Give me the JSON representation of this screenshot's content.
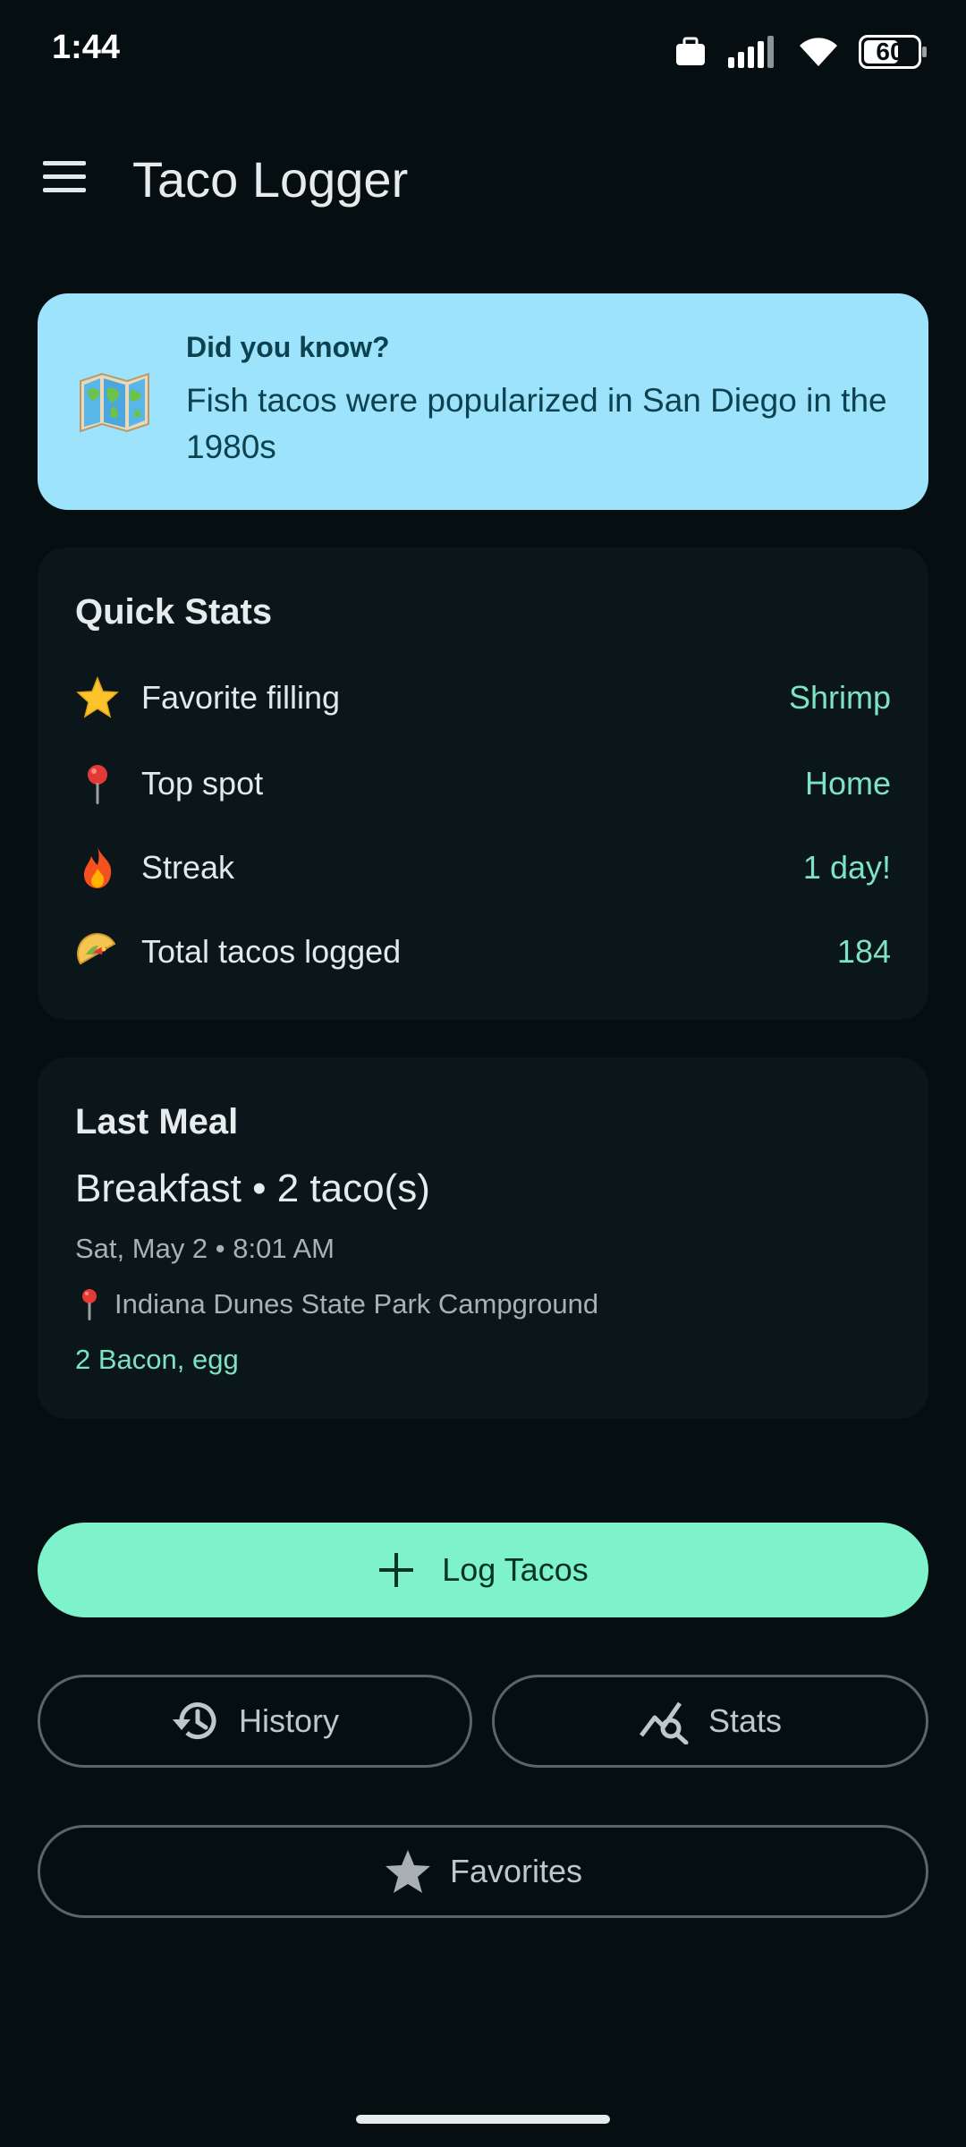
{
  "status_bar": {
    "time": "1:44",
    "battery": "60",
    "battery_level": 0.6,
    "icons": [
      "work-briefcase-icon",
      "signal-icon",
      "wifi-icon",
      "battery-icon"
    ]
  },
  "app_bar": {
    "title": "Taco Logger",
    "menu_icon": "hamburger-menu-icon"
  },
  "tip": {
    "heading": "Did you know?",
    "text": "Fish tacos were popularized in San Diego in the 1980s",
    "icon": "world-map-icon",
    "background": "#9de3fb"
  },
  "quick_stats": {
    "title": "Quick Stats",
    "rows": [
      {
        "icon": "star-icon",
        "label": "Favorite filling",
        "value": "Shrimp"
      },
      {
        "icon": "pin-icon",
        "label": "Top spot",
        "value": "Home"
      },
      {
        "icon": "fire-icon",
        "label": "Streak",
        "value": "1 day!"
      },
      {
        "icon": "taco-icon",
        "label": "Total tacos logged",
        "value": "184"
      }
    ]
  },
  "last_meal": {
    "title": "Last Meal",
    "summary": "Breakfast • 2 taco(s)",
    "datetime": "Sat, May 2 • 8:01 AM",
    "location": "Indiana Dunes State Park Campground",
    "fillings": "2 Bacon, egg"
  },
  "actions": {
    "log_label": "Log Tacos",
    "history_label": "History",
    "stats_label": "Stats",
    "favorites_label": "Favorites"
  },
  "colors": {
    "background": "#050e11",
    "card": "#0b161a",
    "accent": "#7de3c1",
    "primary_button": "#7ef2cb"
  }
}
